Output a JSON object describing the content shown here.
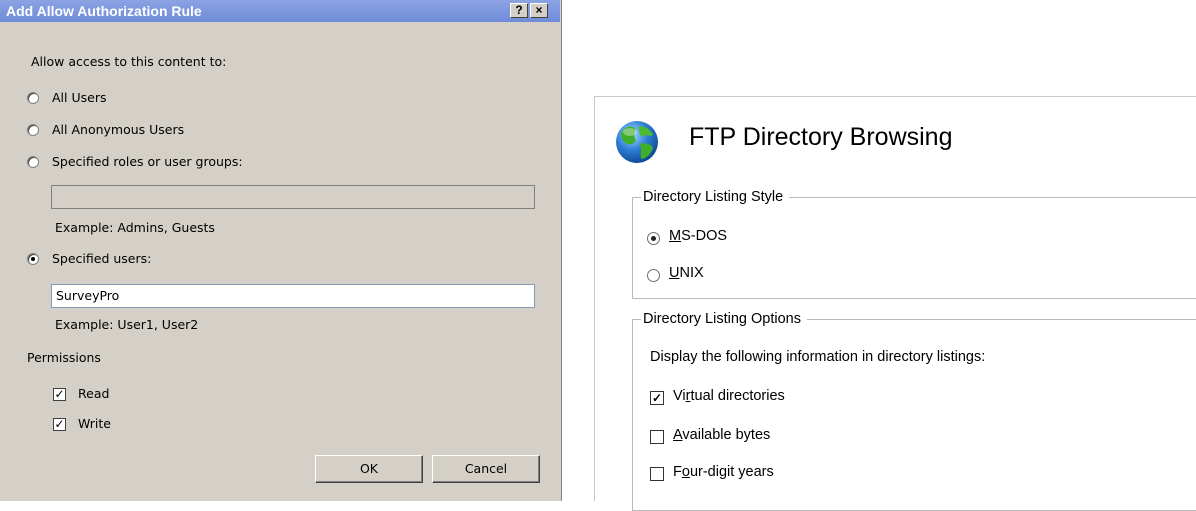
{
  "dialog": {
    "title": "Add Allow Authorization Rule",
    "help_button": "?",
    "close_button": "×",
    "prompt": "Allow access to this content to:",
    "options": {
      "all_users": {
        "label": "All Users",
        "selected": false
      },
      "anonymous": {
        "label": "All Anonymous Users",
        "selected": false
      },
      "roles": {
        "label": "Specified roles or user groups:",
        "selected": false,
        "value": "",
        "example": "Example: Admins, Guests"
      },
      "users": {
        "label": "Specified users:",
        "selected": true,
        "value": "SurveyPro",
        "example": "Example: User1, User2"
      }
    },
    "permissions_label": "Permissions",
    "permissions": {
      "read": {
        "label": "Read",
        "checked": true
      },
      "write": {
        "label": "Write",
        "checked": true
      }
    },
    "ok_label": "OK",
    "cancel_label": "Cancel"
  },
  "ftp": {
    "icon": "globe-icon",
    "title": "FTP Directory Browsing",
    "listing_style": {
      "legend": "Directory Listing Style",
      "msdos": {
        "label_pre": "",
        "mnemonic": "M",
        "label_post": "S-DOS",
        "selected": true
      },
      "unix": {
        "label_pre": "",
        "mnemonic": "U",
        "label_post": "NIX",
        "selected": false
      }
    },
    "listing_options": {
      "legend": "Directory Listing Options",
      "description": "Display the following information in directory listings:",
      "virtual_dirs": {
        "label_pre": "Vi",
        "mnemonic": "r",
        "label_post": "tual directories",
        "checked": true
      },
      "available_bytes": {
        "label_pre": "",
        "mnemonic": "A",
        "label_post": "vailable bytes",
        "checked": false
      },
      "four_digit_years": {
        "label_pre": "F",
        "mnemonic": "o",
        "label_post": "ur-digit years",
        "checked": false
      }
    }
  }
}
